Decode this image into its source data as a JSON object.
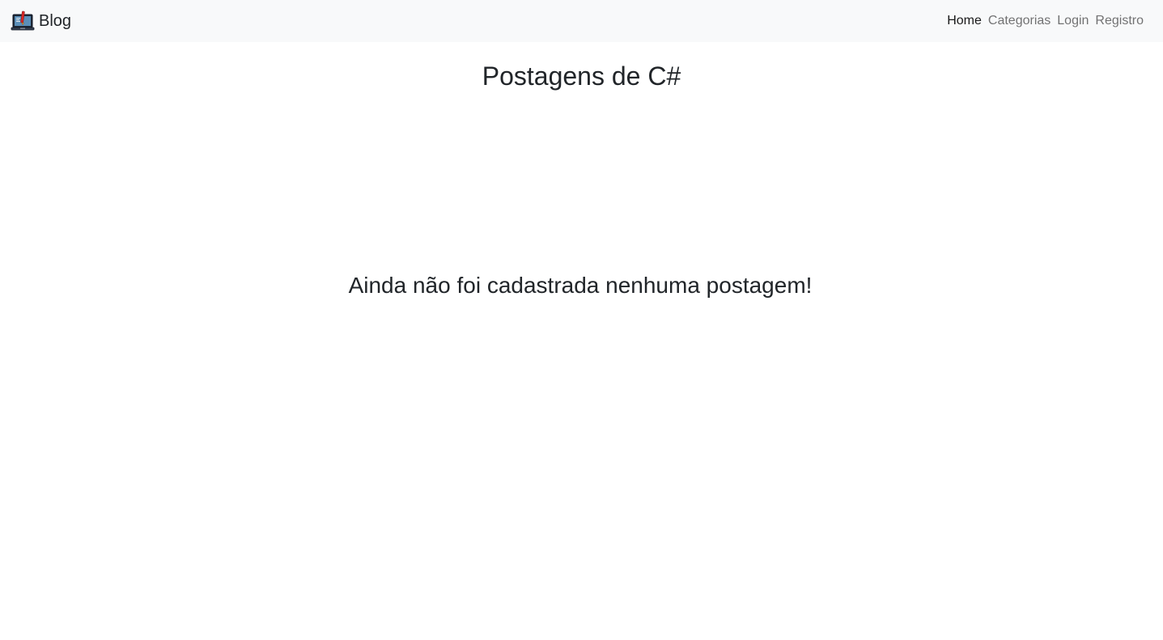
{
  "navbar": {
    "brand": {
      "icon": "laptop-pen-icon",
      "label": "Blog"
    },
    "links": [
      {
        "label": "Home",
        "active": true
      },
      {
        "label": "Categorias",
        "active": false
      },
      {
        "label": "Login",
        "active": false
      },
      {
        "label": "Registro",
        "active": false
      }
    ],
    "colors": {
      "background": "#f8f9fa",
      "active_link": "#212529",
      "inactive_link": "#8c8c8c"
    }
  },
  "main": {
    "title": "Postagens de C#",
    "empty_message": "Ainda não foi cadastrada nenhuma postagem!"
  }
}
